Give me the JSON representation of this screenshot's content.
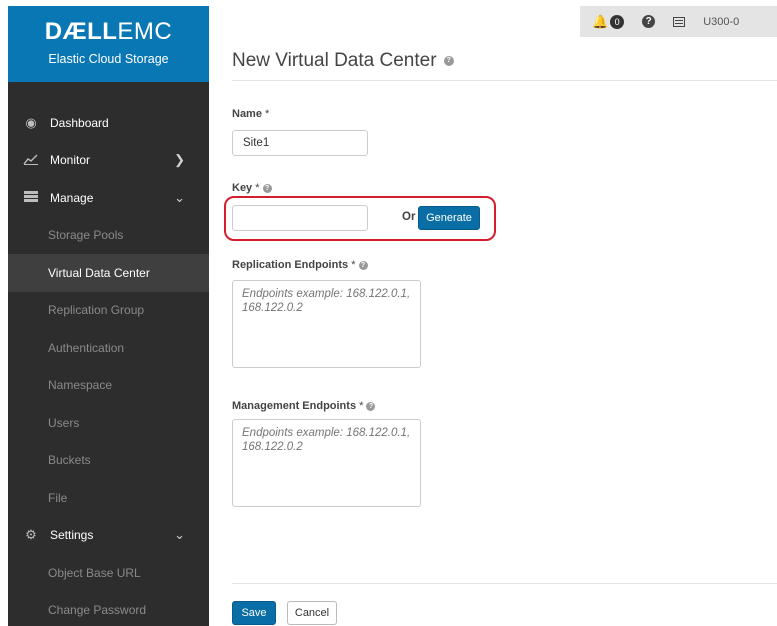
{
  "brand": {
    "logo_bold": "DÆLL",
    "logo_light": "EMC",
    "product": "Elastic Cloud Storage"
  },
  "sidebar": {
    "items": [
      {
        "label": "Dashboard",
        "icon": "dashboard-icon"
      },
      {
        "label": "Monitor",
        "icon": "monitor-chart-icon"
      },
      {
        "label": "Manage",
        "icon": "manage-icon"
      },
      {
        "label": "Storage Pools"
      },
      {
        "label": "Virtual Data Center"
      },
      {
        "label": "Replication Group"
      },
      {
        "label": "Authentication"
      },
      {
        "label": "Namespace"
      },
      {
        "label": "Users"
      },
      {
        "label": "Buckets"
      },
      {
        "label": "File"
      },
      {
        "label": "Settings",
        "icon": "gear-icon"
      },
      {
        "label": "Object Base URL"
      },
      {
        "label": "Change Password"
      }
    ]
  },
  "topbar": {
    "alerts_count": "0",
    "user": "U300-0"
  },
  "page": {
    "title": "New Virtual Data Center"
  },
  "form": {
    "name_label": "Name",
    "name_value": "Site1",
    "key_label": "Key",
    "key_value": "",
    "or_text": "Or",
    "generate_label": "Generate",
    "replication_label": "Replication Endpoints",
    "replication_placeholder": "Endpoints example: 168.122.0.1, 168.122.0.2",
    "management_label": "Management Endpoints",
    "management_placeholder": "Endpoints example: 168.122.0.1, 168.122.0.2",
    "required_mark": "*"
  },
  "footer": {
    "save_label": "Save",
    "cancel_label": "Cancel"
  },
  "colors": {
    "brand_blue": "#0a77b5",
    "sidebar_bg": "#2d2d2d",
    "primary_button": "#0a6ea6",
    "highlight_red": "#d31f2d"
  }
}
